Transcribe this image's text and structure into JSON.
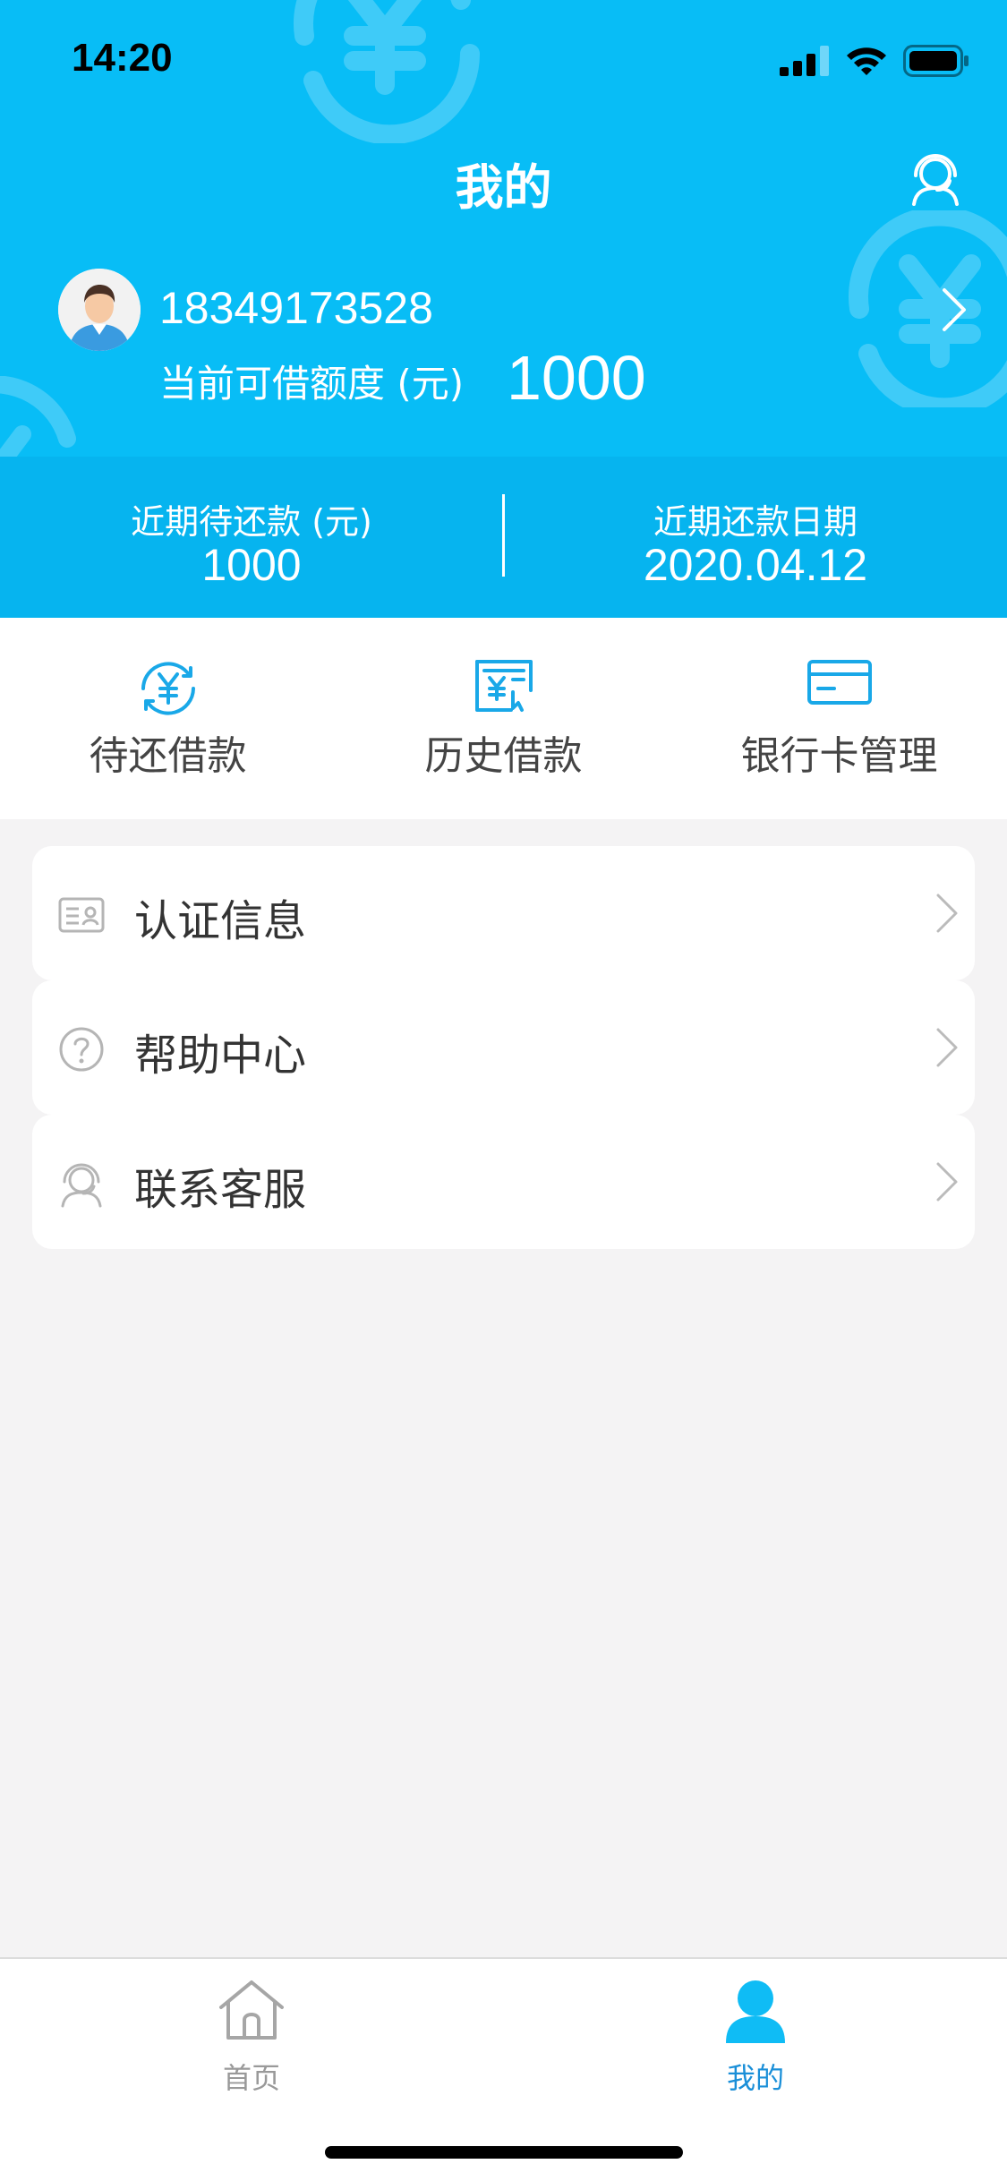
{
  "status_bar": {
    "time": "14:20"
  },
  "header": {
    "title": "我的",
    "phone": "18349173528",
    "quota_label": "当前可借额度 (元)",
    "quota_value": "1000"
  },
  "summary": {
    "pending_label": "近期待还款 (元)",
    "pending_value": "1000",
    "date_label": "近期还款日期",
    "date_value": "2020.04.12"
  },
  "actions": [
    {
      "label": "待还借款",
      "icon": "yen-refresh-icon"
    },
    {
      "label": "历史借款",
      "icon": "receipt-icon"
    },
    {
      "label": "银行卡管理",
      "icon": "bank-card-icon"
    }
  ],
  "menu": [
    {
      "label": "认证信息",
      "icon": "id-card-icon"
    },
    {
      "label": "帮助中心",
      "icon": "help-icon"
    },
    {
      "label": "联系客服",
      "icon": "customer-service-icon"
    }
  ],
  "tabbar": [
    {
      "label": "首页",
      "icon": "home-icon",
      "active": false
    },
    {
      "label": "我的",
      "icon": "person-icon",
      "active": true
    }
  ],
  "colors": {
    "brand": "#08bdf6",
    "brand_dark": "#06b4ef",
    "tab_active": "#1a8fd8",
    "tab_inactive": "#999999"
  }
}
